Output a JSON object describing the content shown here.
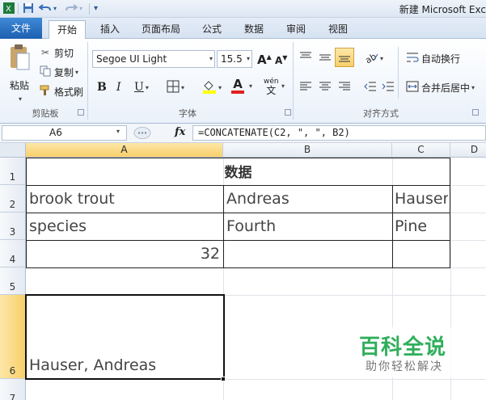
{
  "title_bar": {
    "app_title": "新建 Microsoft Exc",
    "quick_access": [
      "save-icon",
      "undo-icon",
      "redo-icon",
      "customize-icon"
    ]
  },
  "tabs": [
    {
      "id": "file",
      "label": "文件"
    },
    {
      "id": "home",
      "label": "开始"
    },
    {
      "id": "insert",
      "label": "插入"
    },
    {
      "id": "page-layout",
      "label": "页面布局"
    },
    {
      "id": "formulas",
      "label": "公式"
    },
    {
      "id": "data",
      "label": "数据"
    },
    {
      "id": "review",
      "label": "审阅"
    },
    {
      "id": "view",
      "label": "视图"
    }
  ],
  "ribbon": {
    "clipboard": {
      "paste": "粘贴",
      "cut": "剪切",
      "copy": "复制",
      "format_painter": "格式刷",
      "group_label": "剪贴板"
    },
    "font": {
      "font_name": "Segoe UI Light",
      "font_size": "15.5",
      "bold": "B",
      "italic": "I",
      "underline": "U",
      "font_color_glyph": "A",
      "grow_glyph": "A",
      "shrink_glyph": "A",
      "phonetic": "wén",
      "group_label": "字体"
    },
    "alignment": {
      "wrap_text": "自动换行",
      "merge_center": "合并后居中",
      "group_label": "对齐方式"
    }
  },
  "formula_bar": {
    "name_box": "A6",
    "fx": "fx",
    "formula": "=CONCATENATE(C2, \", \", B2)"
  },
  "grid": {
    "columns": [
      "A",
      "B",
      "C",
      "D"
    ],
    "rows": [
      "1",
      "2",
      "3",
      "4",
      "5",
      "6",
      "7"
    ],
    "cells": {
      "A1": "数据",
      "A2": "brook trout",
      "B2": "Andreas",
      "C2": "Hauser",
      "A3": "species",
      "B3": "Fourth",
      "C3": "Pine",
      "A4": "32",
      "A6": "Hauser, Andreas"
    }
  },
  "watermark": {
    "title": "百科全说",
    "subtitle": "助你轻松解决"
  },
  "colors": {
    "file_tab": "#2b6cc4",
    "selection_header": "#f8cf6a",
    "watermark_green": "#2fae5b"
  }
}
